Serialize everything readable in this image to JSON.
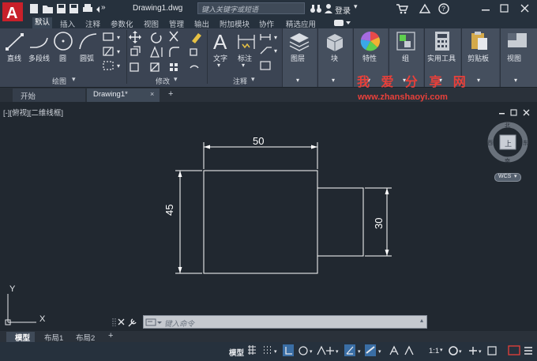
{
  "titlebar": {
    "filename": "Drawing1.dwg",
    "search_placeholder": "键入关键字或短语",
    "login_label": "登录",
    "overflow": "»"
  },
  "ribbon_tabs": [
    "默认",
    "插入",
    "注释",
    "参数化",
    "视图",
    "管理",
    "输出",
    "附加模块",
    "协作",
    "精选应用"
  ],
  "ribbon": {
    "draw": {
      "line": "直线",
      "polyline": "多段线",
      "circle": "圆",
      "arc": "圆弧",
      "title": "绘图"
    },
    "modify_title": "修改",
    "annotation": {
      "text": "文字",
      "dimension": "标注",
      "title": "注释"
    },
    "layers": "图层",
    "block": "块",
    "properties": "特性",
    "group": "组",
    "utilities": "实用工具",
    "clipboard": "剪贴板",
    "view": "视图"
  },
  "file_tabs": {
    "start": "开始",
    "drawing": "Drawing1*",
    "add": "+"
  },
  "viewport": {
    "label": "[-][俯视][二维线框]",
    "watermark_title": "我 爱 分 享 网",
    "watermark_url": "www.zhanshaoyi.com",
    "dim_width": "50",
    "dim_height_left": "45",
    "dim_height_right": "30",
    "axis_y": "Y",
    "axis_x": "X"
  },
  "viewcube": {
    "north": "北",
    "south": "南",
    "east": "东",
    "west": "西",
    "top": "上",
    "wcs": "WCS"
  },
  "command": {
    "placeholder": "键入命令"
  },
  "layout_tabs": [
    "模型",
    "布局1",
    "布局2"
  ],
  "layout_add": "+",
  "status": {
    "model": "模型",
    "scale": "1:1"
  },
  "colors": {
    "accent_red": "#c8202a",
    "viewport_bg": "#212830",
    "ribbon_bg": "#3b4453"
  }
}
